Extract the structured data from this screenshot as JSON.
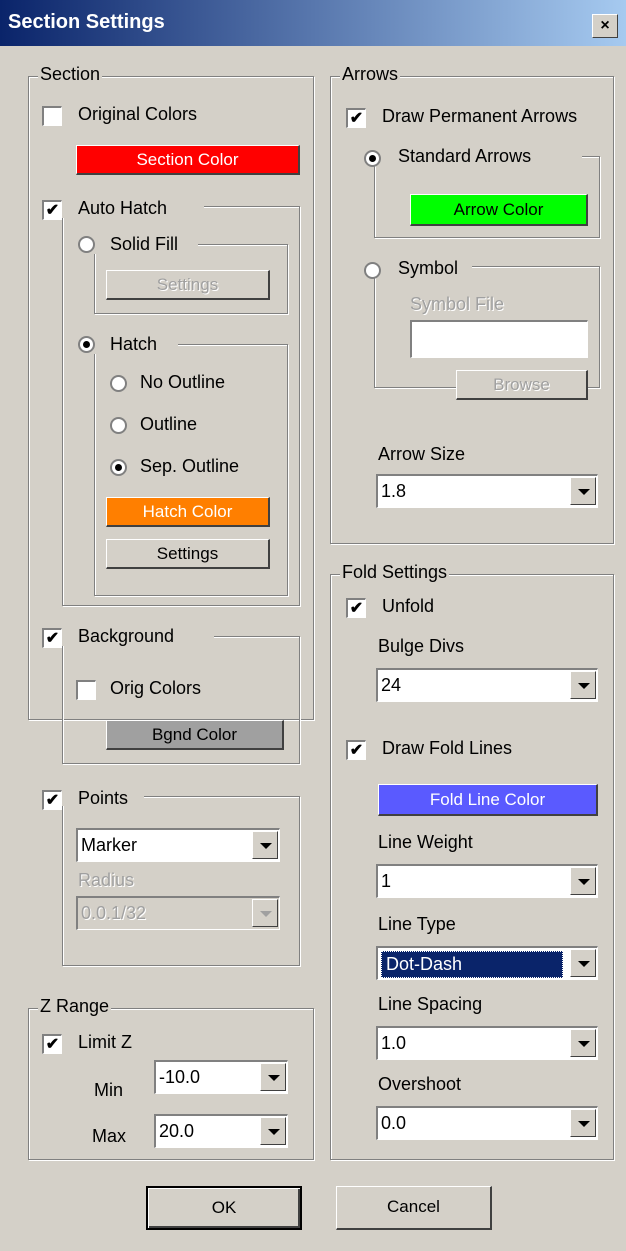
{
  "window": {
    "title": "Section Settings",
    "close": "×"
  },
  "section": {
    "legend": "Section",
    "original_colors": "Original Colors",
    "section_color": "Section Color",
    "auto_hatch": "Auto Hatch",
    "solid_fill": "Solid Fill",
    "solid_settings": "Settings",
    "hatch": "Hatch",
    "no_outline": "No Outline",
    "outline": "Outline",
    "sep_outline": "Sep. Outline",
    "hatch_color": "Hatch Color",
    "hatch_settings": "Settings",
    "background": "Background",
    "orig_colors": "Orig Colors",
    "bgnd_color": "Bgnd Color",
    "points": "Points",
    "marker": "Marker",
    "radius": "Radius",
    "radius_value": "0.0.1/32"
  },
  "zrange": {
    "legend": "Z Range",
    "limit_z": "Limit Z",
    "min_label": "Min",
    "min_value": "-10.0",
    "max_label": "Max",
    "max_value": "20.0"
  },
  "arrows": {
    "legend": "Arrows",
    "draw_permanent": "Draw Permanent Arrows",
    "standard": "Standard Arrows",
    "arrow_color": "Arrow Color",
    "symbol": "Symbol",
    "symbol_file": "Symbol File",
    "browse": "Browse",
    "arrow_size": "Arrow Size",
    "arrow_size_value": "1.8"
  },
  "fold": {
    "legend": "Fold Settings",
    "unfold": "Unfold",
    "bulge_divs": "Bulge Divs",
    "bulge_value": "24",
    "draw_fold_lines": "Draw Fold Lines",
    "fold_line_color": "Fold Line Color",
    "line_weight": "Line Weight",
    "line_weight_value": "1",
    "line_type": "Line Type",
    "line_type_value": "Dot-Dash",
    "line_spacing": "Line Spacing",
    "line_spacing_value": "1.0",
    "overshoot": "Overshoot",
    "overshoot_value": "0.0"
  },
  "footer": {
    "ok": "OK",
    "cancel": "Cancel"
  },
  "colors": {
    "section": "#ff0000",
    "arrow": "#00ff00",
    "hatch": "#ff7f00",
    "bgnd": "#a0a0a0",
    "fold_line": "#5a5aff",
    "title_bar": "#0a246a",
    "face": "#d4d0c8"
  },
  "check": "✔"
}
